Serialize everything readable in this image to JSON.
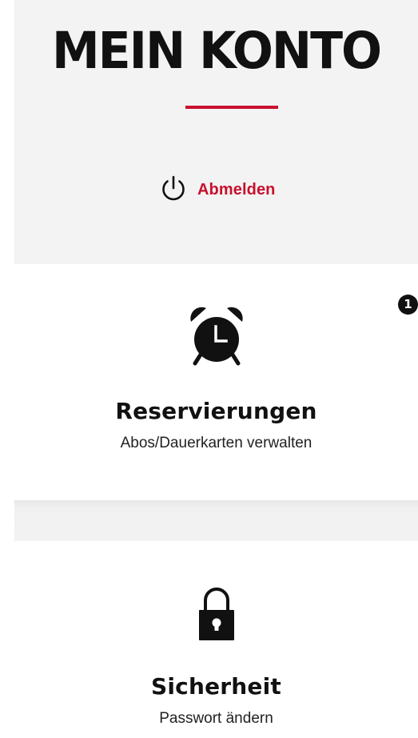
{
  "header": {
    "title": "MEIN KONTO",
    "logout_label": "Abmelden"
  },
  "cards": [
    {
      "id": "reservierungen",
      "icon": "alarm-clock-icon",
      "title": "Reservierungen",
      "subtitle": "Abos/Dauerkarten verwalten",
      "badge": "1"
    },
    {
      "id": "sicherheit",
      "icon": "lock-icon",
      "title": "Sicherheit",
      "subtitle": "Passwort ändern"
    }
  ],
  "colors": {
    "accent": "#c8102e",
    "text": "#111111",
    "header_background": "#f3f3f3",
    "card_background": "#ffffff"
  }
}
